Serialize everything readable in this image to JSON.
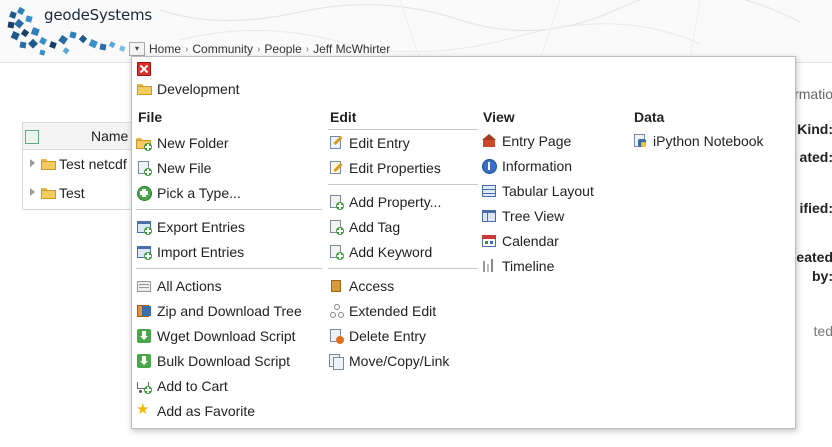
{
  "brand": {
    "name": "geodeSystems"
  },
  "breadcrumb": {
    "toggle": "▾",
    "items": [
      "Home",
      "Community",
      "People",
      "Jeff McWhirter"
    ],
    "separator": "›"
  },
  "entries": {
    "header_label": "Name",
    "rows": [
      "Test netcdf",
      "Test"
    ]
  },
  "right_panel": {
    "partial_title": "rmatio",
    "labels": [
      "Kind:",
      "ated:",
      "ified:",
      "eated",
      "by:",
      "ted"
    ]
  },
  "menu": {
    "title": "Development",
    "columns": [
      {
        "heading": "File",
        "groups": [
          [
            {
              "label": "New Folder",
              "icon": "new-folder-icon"
            },
            {
              "label": "New File",
              "icon": "new-file-icon"
            },
            {
              "label": "Pick a Type...",
              "icon": "pick-type-icon"
            }
          ],
          [
            {
              "label": "Export Entries",
              "icon": "export-icon"
            },
            {
              "label": "Import Entries",
              "icon": "import-icon"
            }
          ],
          [
            {
              "label": "All Actions",
              "icon": "all-actions-icon"
            },
            {
              "label": "Zip and Download Tree",
              "icon": "zip-icon"
            },
            {
              "label": "Wget Download Script",
              "icon": "wget-download-icon"
            },
            {
              "label": "Bulk Download Script",
              "icon": "bulk-download-icon"
            },
            {
              "label": "Add to Cart",
              "icon": "cart-icon"
            },
            {
              "label": "Add as Favorite",
              "icon": "star-icon"
            }
          ]
        ]
      },
      {
        "heading": "Edit",
        "groups": [
          [
            {
              "label": "Edit Entry",
              "icon": "edit-entry-icon"
            },
            {
              "label": "Edit Properties",
              "icon": "edit-properties-icon"
            }
          ],
          [
            {
              "label": "Add Property...",
              "icon": "add-property-icon"
            },
            {
              "label": "Add Tag",
              "icon": "add-tag-icon"
            },
            {
              "label": "Add Keyword",
              "icon": "add-keyword-icon"
            }
          ],
          [
            {
              "label": "Access",
              "icon": "access-icon"
            },
            {
              "label": "Extended Edit",
              "icon": "extended-edit-icon"
            },
            {
              "label": "Delete Entry",
              "icon": "delete-entry-icon"
            },
            {
              "label": "Move/Copy/Link",
              "icon": "move-copy-icon"
            }
          ]
        ]
      },
      {
        "heading": "View",
        "groups": [
          [
            {
              "label": "Entry Page",
              "icon": "entry-page-icon"
            },
            {
              "label": "Information",
              "icon": "information-icon"
            },
            {
              "label": "Tabular Layout",
              "icon": "tabular-icon"
            },
            {
              "label": "Tree View",
              "icon": "tree-view-icon"
            },
            {
              "label": "Calendar",
              "icon": "calendar-icon"
            },
            {
              "label": "Timeline",
              "icon": "timeline-icon"
            }
          ]
        ]
      },
      {
        "heading": "Data",
        "groups": [
          [
            {
              "label": "iPython Notebook",
              "icon": "ipython-icon"
            }
          ]
        ]
      }
    ]
  }
}
